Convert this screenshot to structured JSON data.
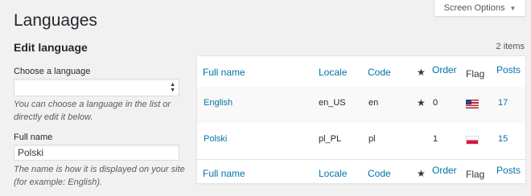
{
  "page": {
    "title": "Languages"
  },
  "screen_options": {
    "label": "Screen Options",
    "caret_icon": "triangle-down-icon"
  },
  "form": {
    "section_title": "Edit language",
    "choose_label": "Choose a language",
    "choose_selected": "",
    "choose_description": "You can choose a language in the list or directly edit it below.",
    "fullname_label": "Full name",
    "fullname_value": "Polski",
    "fullname_description": "The name is how it is displayed on your site (for example: English)."
  },
  "table": {
    "items_count": "2 items",
    "columns": {
      "full_name": "Full name",
      "locale": "Locale",
      "code": "Code",
      "default_icon": "star-icon",
      "order": "Order",
      "flag": "Flag",
      "posts": "Posts"
    },
    "rows": [
      {
        "full_name": "English",
        "locale": "en_US",
        "code": "en",
        "is_default": true,
        "order": "0",
        "flag": "us-flag-icon",
        "posts": "17"
      },
      {
        "full_name": "Polski",
        "locale": "pl_PL",
        "code": "pl",
        "is_default": false,
        "order": "1",
        "flag": "pl-flag-icon",
        "posts": "15"
      }
    ]
  },
  "colors": {
    "link": "#0073aa",
    "background": "#f1f1f1"
  }
}
